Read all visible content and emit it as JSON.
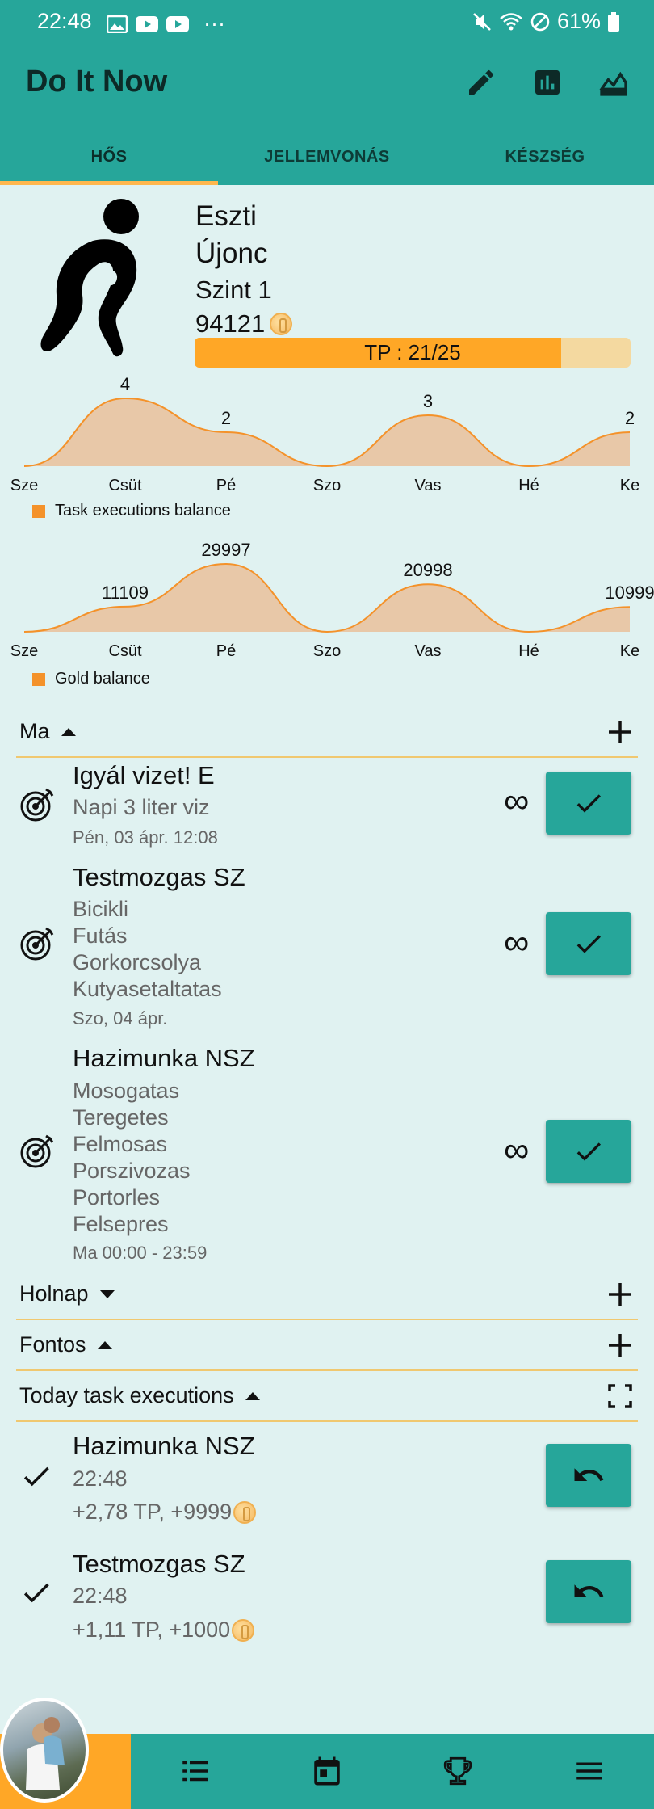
{
  "status_bar": {
    "time": "22:48",
    "dots": "···",
    "battery": "61%"
  },
  "app": {
    "title": "Do It Now"
  },
  "tabs": [
    {
      "label": "HŐS",
      "active": true
    },
    {
      "label": "JELLEMVONÁS",
      "active": false
    },
    {
      "label": "KÉSZSÉG",
      "active": false
    }
  ],
  "hero": {
    "name": "Eszti",
    "rank": "Újonc",
    "level": "Szint 1",
    "gold": "94121",
    "tp_label": "TP : 21/25",
    "tp_progress": 0.84
  },
  "chart_data": [
    {
      "type": "area",
      "categories": [
        "Sze",
        "Csüt",
        "Pé",
        "Szo",
        "Vas",
        "Hé",
        "Ke"
      ],
      "values": [
        0,
        4,
        2,
        0,
        3,
        0,
        2
      ],
      "value_labels": [
        "",
        "4",
        "2",
        "",
        "3",
        "",
        "2"
      ],
      "legend": "Task executions balance",
      "color": "#f4922a",
      "fill": "#e8c8a8"
    },
    {
      "type": "area",
      "categories": [
        "Sze",
        "Csüt",
        "Pé",
        "Szo",
        "Vas",
        "Hé",
        "Ke"
      ],
      "values": [
        0,
        11109,
        29997,
        0,
        20998,
        0,
        10999
      ],
      "value_labels": [
        "",
        "11109",
        "29997",
        "",
        "20998",
        "",
        "10999"
      ],
      "legend": "Gold balance",
      "color": "#f4922a",
      "fill": "#e8c8a8"
    }
  ],
  "sections": {
    "today": "Ma",
    "tomorrow": "Holnap",
    "important": "Fontos",
    "executions": "Today task executions"
  },
  "tasks": [
    {
      "name": "Igyál vizet! E",
      "subs": [
        "Napi 3 liter viz"
      ],
      "date": "Pén, 03 ápr. 12:08",
      "repeat": "∞"
    },
    {
      "name": "Testmozgas SZ",
      "subs": [
        "Bicikli",
        "Futás",
        "Gorkorcsolya",
        "Kutyasetaltatas"
      ],
      "date": "Szo, 04 ápr.",
      "repeat": "∞"
    },
    {
      "name": "Hazimunka NSZ",
      "subs": [
        "Mosogatas",
        "Teregetes",
        "Felmosas",
        "Porszivozas",
        "Portorles",
        "Felsepres"
      ],
      "date": "Ma 00:00 - 23:59",
      "repeat": "∞"
    }
  ],
  "executions": [
    {
      "name": "Hazimunka NSZ",
      "time": "22:48",
      "reward": "+2,78 TP, +9999"
    },
    {
      "name": "Testmozgas SZ",
      "time": "22:48",
      "reward": "+1,11 TP, +1000"
    }
  ],
  "colors": {
    "primary": "#26a69a",
    "accent": "#ffa726",
    "background": "#e0f2f1"
  }
}
